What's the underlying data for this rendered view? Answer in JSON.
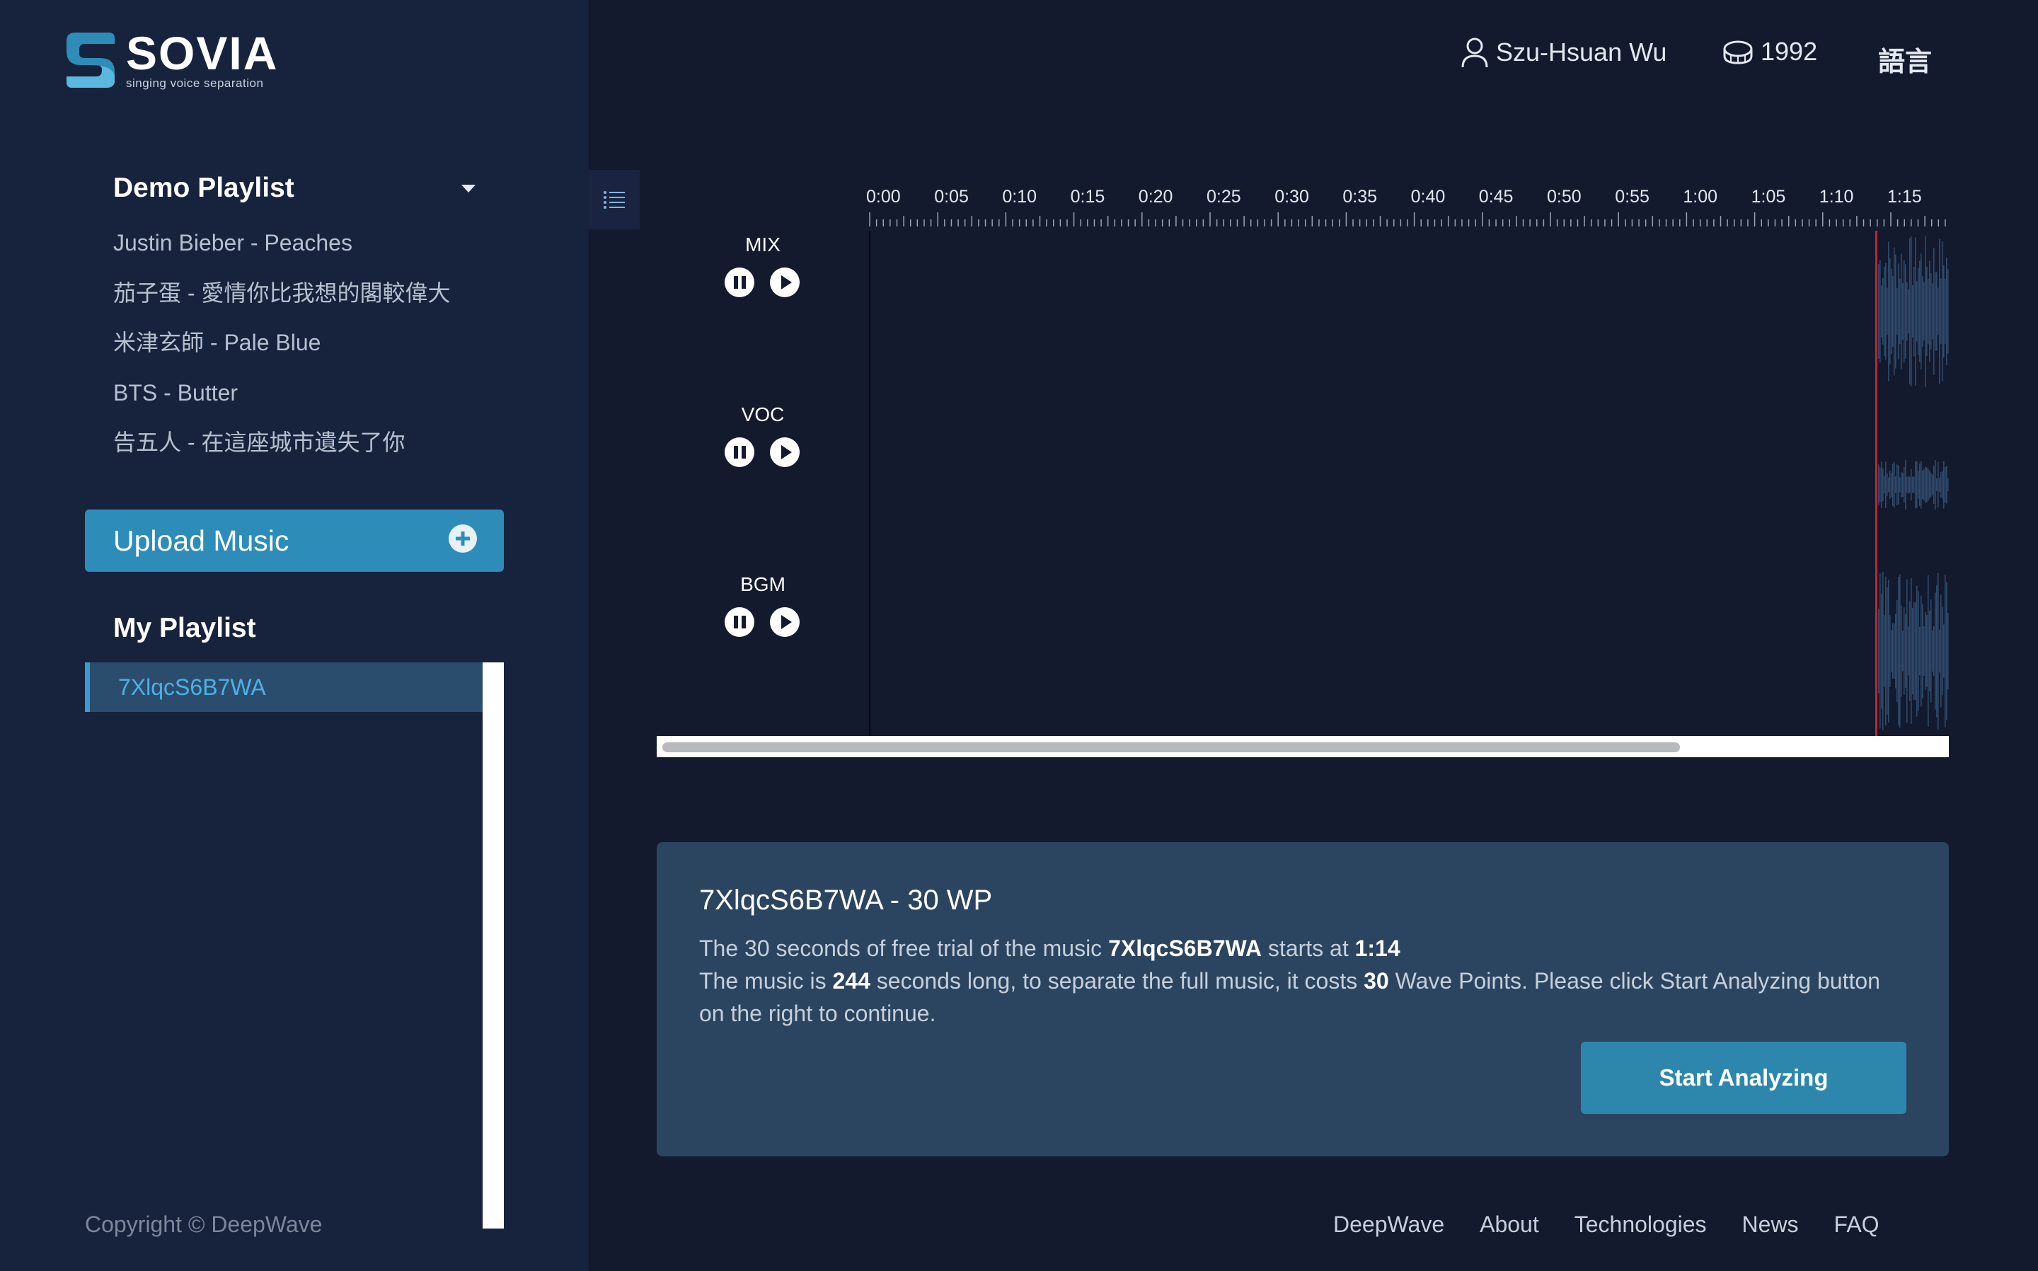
{
  "brand": {
    "name": "SOVIA",
    "tagline": "singing voice separation",
    "colors": {
      "accent": "#2e8db8",
      "sidebar_bg": "#17223d",
      "main_bg": "#131a2e",
      "panel_bg": "#2b4560",
      "playhead": "#c0262f"
    }
  },
  "topbar": {
    "user_name": "Szu-Hsuan Wu",
    "coin_count": "1992",
    "language_label": "語言"
  },
  "sidebar": {
    "demo_title": "Demo Playlist",
    "demo_items": [
      "Justin Bieber - Peaches",
      "茄子蛋 - 愛情你比我想的閣較偉大",
      "米津玄師 - Pale Blue",
      "BTS - Butter",
      "告五人 - 在這座城市遺失了你"
    ],
    "upload_label": "Upload Music",
    "my_title": "My Playlist",
    "my_items": [
      "7XlqcS6B7WA"
    ],
    "copyright": "Copyright © DeepWave"
  },
  "player": {
    "tracks": [
      "MIX",
      "VOC",
      "BGM"
    ],
    "time_ticks": [
      "0:00",
      "0:05",
      "0:10",
      "0:15",
      "0:20",
      "0:25",
      "0:30",
      "0:35",
      "0:40",
      "0:45",
      "0:50",
      "0:55",
      "1:00",
      "1:05",
      "1:10",
      "1:15"
    ]
  },
  "info": {
    "title": "7XlqcS6B7WA - 30 WP",
    "l1_a": "The 30 seconds of free trial of the music ",
    "l1_b": "7XlqcS6B7WA",
    "l1_c": " starts at ",
    "l1_d": "1:14",
    "l2_a": "The music is ",
    "l2_b": "244",
    "l2_c": " seconds long, to separate the full music, it costs ",
    "l2_d": "30",
    "l2_e": " Wave Points. Please click Start Analyzing button on the right to continue.",
    "button": "Start Analyzing"
  },
  "footer": {
    "links": [
      "DeepWave",
      "About",
      "Technologies",
      "News",
      "FAQ"
    ]
  }
}
